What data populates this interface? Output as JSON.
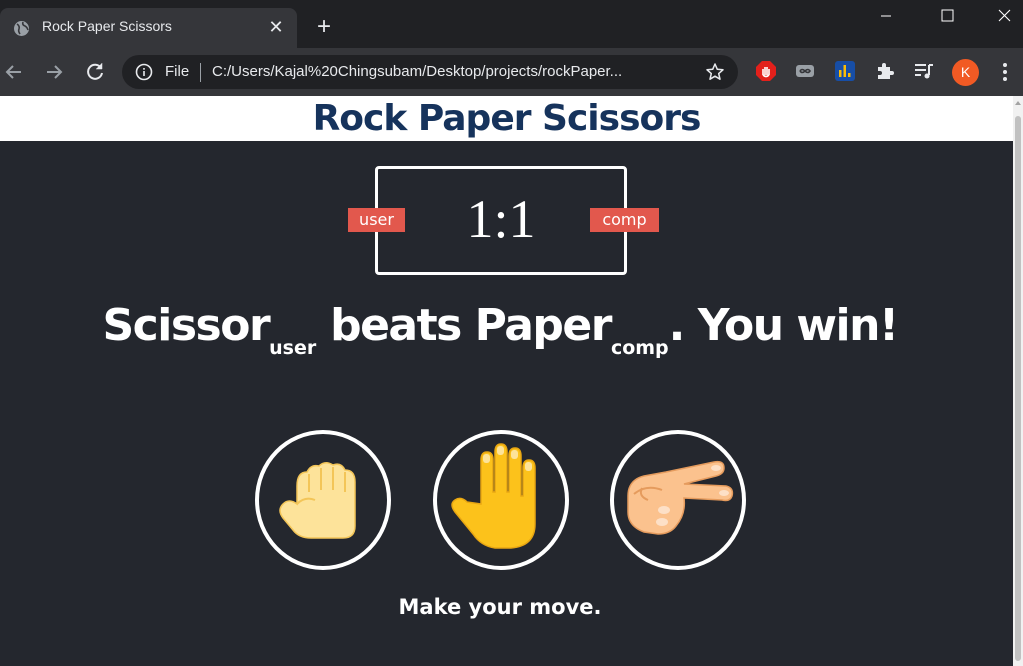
{
  "browser": {
    "tab_title": "Rock Paper Scissors",
    "scheme_label": "File",
    "url": "C:/Users/Kajal%20Chingsubam/Desktop/projects/rockPaper...",
    "profile_initial": "K"
  },
  "page": {
    "title": "Rock Paper Scissors",
    "score": "1:1",
    "user_badge": "user",
    "comp_badge": "comp",
    "result": {
      "user_choice": "Scissor",
      "user_sub": "user",
      "verb": " beats ",
      "comp_choice": "Paper",
      "comp_sub": "comp",
      "suffix": ". You win!"
    },
    "prompt": "Make your move."
  },
  "colors": {
    "page_background": "#24272e",
    "title": "#16335c",
    "badge": "#e2584d"
  },
  "icons": {
    "choices": [
      "rock-fist-icon",
      "paper-hand-icon",
      "scissors-hand-icon"
    ]
  }
}
